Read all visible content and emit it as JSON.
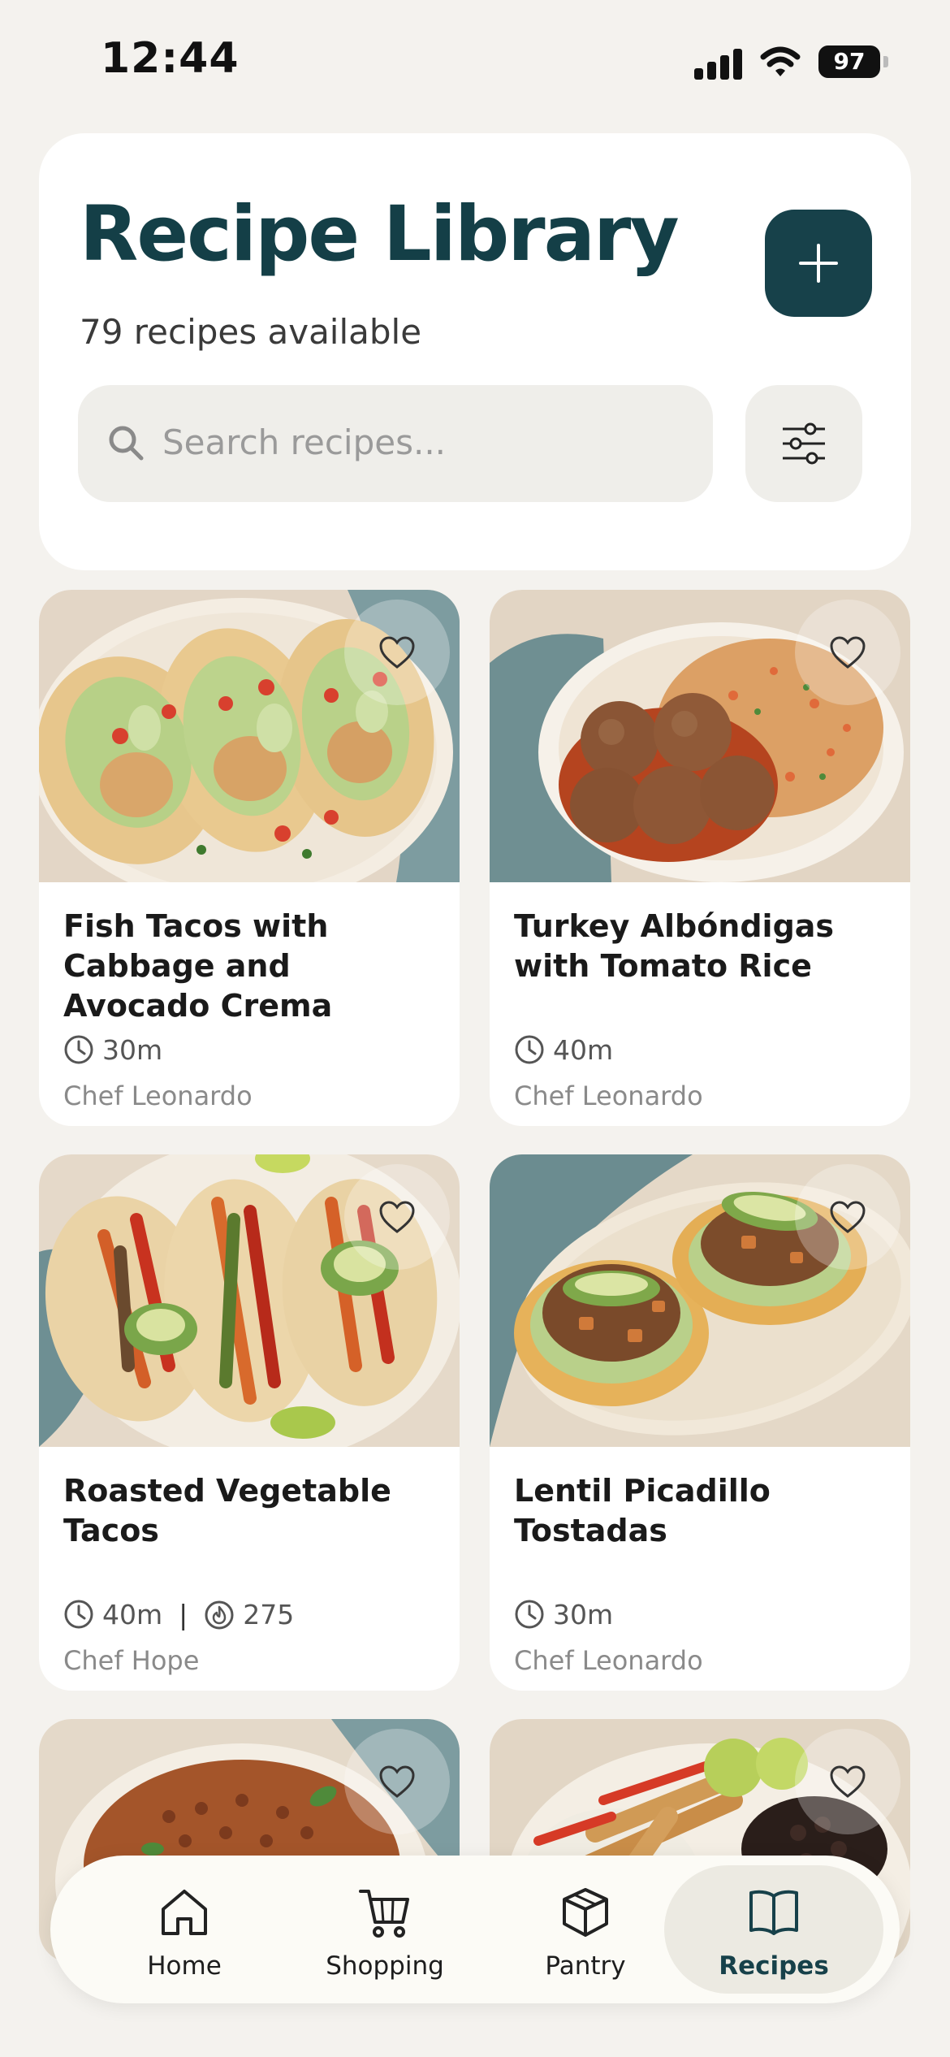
{
  "status_bar": {
    "time": "12:44",
    "battery": "97"
  },
  "header": {
    "title": "Recipe Library",
    "subtitle": "79 recipes available",
    "add_icon": "plus-icon",
    "search": {
      "placeholder": "Search recipes...",
      "icon": "search-icon"
    },
    "filter_icon": "sliders-icon"
  },
  "recipes": [
    {
      "title": "Fish Tacos with Cabbage and Avocado Crema",
      "time": "30m",
      "calories": "",
      "author": "Chef Leonardo"
    },
    {
      "title": "Turkey Albóndigas with Tomato Rice",
      "time": "40m",
      "calories": "",
      "author": "Chef Leonardo"
    },
    {
      "title": "Roasted Vegetable Tacos",
      "time": "40m",
      "calories": "275",
      "author": "Chef Hope"
    },
    {
      "title": "Lentil Picadillo Tostadas",
      "time": "30m",
      "calories": "",
      "author": "Chef Leonardo"
    }
  ],
  "nav": [
    {
      "label": "Home",
      "icon": "home-icon"
    },
    {
      "label": "Shopping",
      "icon": "cart-icon"
    },
    {
      "label": "Pantry",
      "icon": "box-icon"
    },
    {
      "label": "Recipes",
      "icon": "book-icon",
      "active": true
    }
  ],
  "colors": {
    "accent": "#17414a",
    "background": "#f4f2ee"
  }
}
